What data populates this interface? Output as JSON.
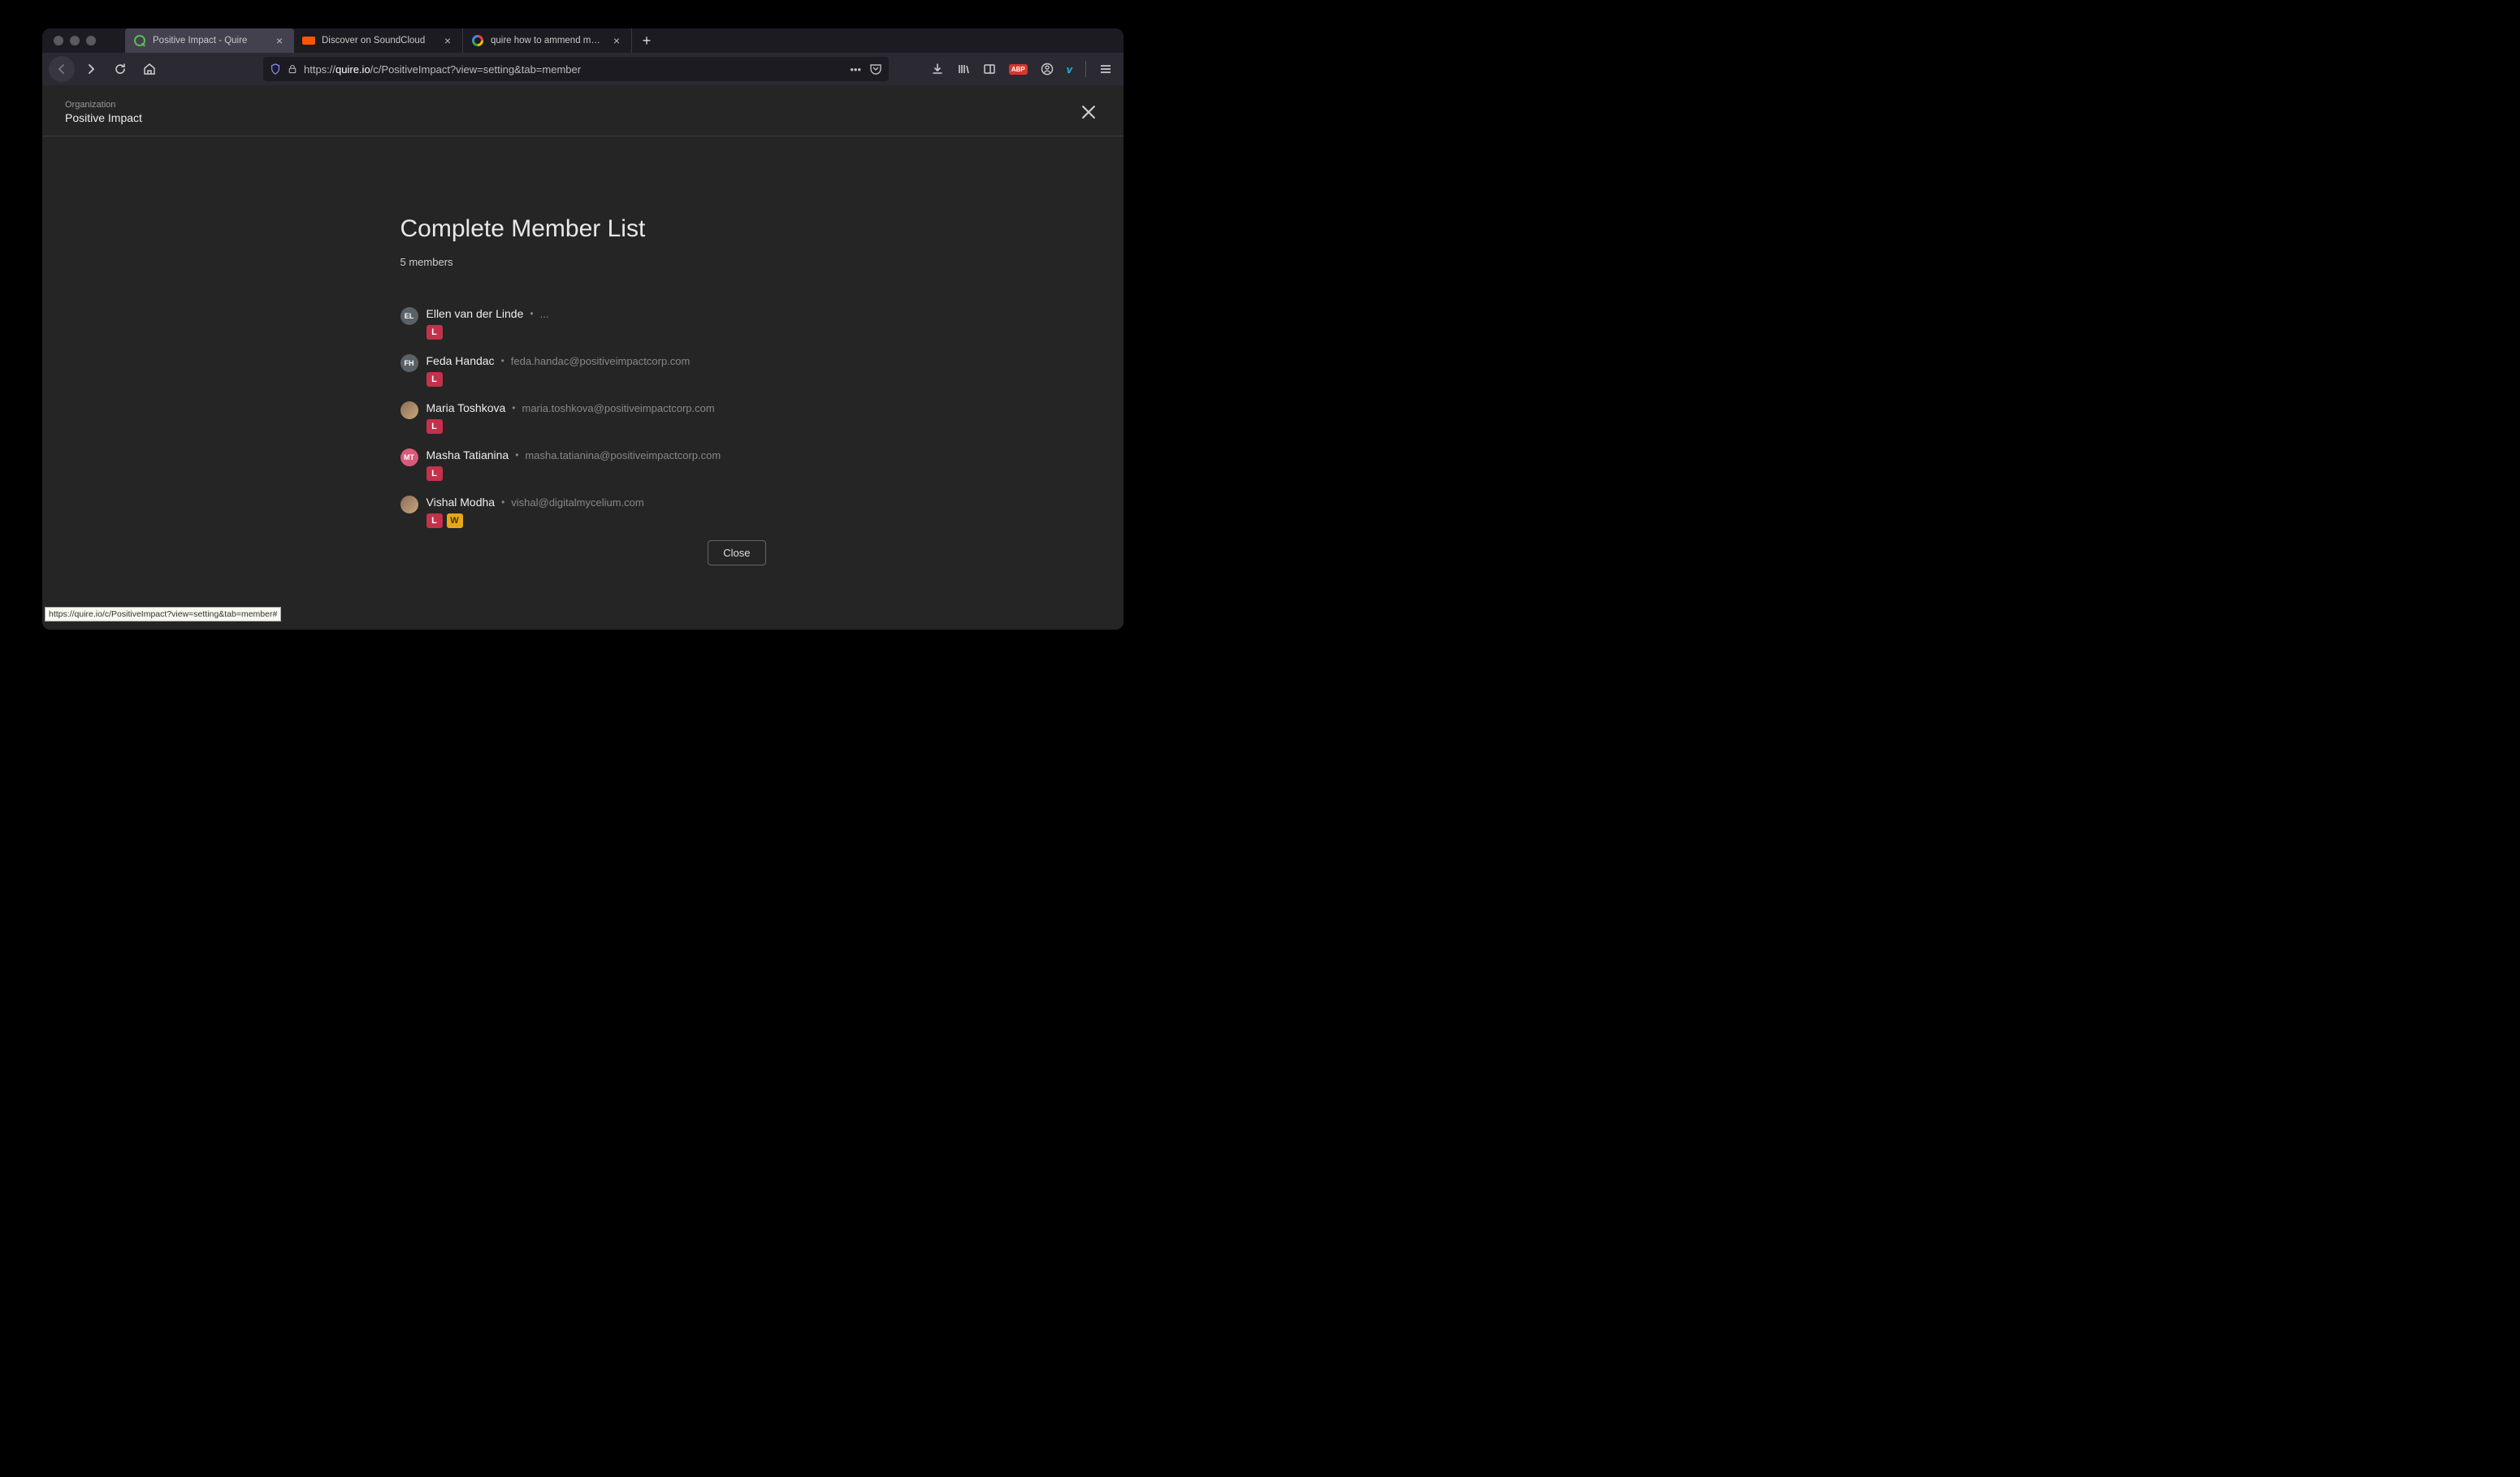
{
  "tabs": [
    {
      "title": "Positive Impact - Quire"
    },
    {
      "title": "Discover on SoundCloud"
    },
    {
      "title": "quire how to ammend members"
    }
  ],
  "url": {
    "protocol": "https://",
    "domain": "quire.io",
    "path": "/c/PositiveImpact?view=setting&tab=member"
  },
  "breadcrumb": {
    "label": "Organization",
    "name": "Positive Impact"
  },
  "title": "Complete Member List",
  "memberCount": "5 members",
  "members": [
    {
      "initials": "EL",
      "avatarColor": "#5a6268",
      "avatarType": "initials",
      "name": "Ellen van der Linde",
      "email": "...",
      "roles": [
        "L"
      ]
    },
    {
      "initials": "FH",
      "avatarColor": "#5a6268",
      "avatarType": "initials",
      "name": "Feda Handac",
      "email": "feda.handac@positiveimpactcorp.com",
      "roles": [
        "L"
      ]
    },
    {
      "initials": "",
      "avatarColor": "",
      "avatarType": "image",
      "name": "Maria Toshkova",
      "email": "maria.toshkova@positiveimpactcorp.com",
      "roles": [
        "L"
      ]
    },
    {
      "initials": "MT",
      "avatarColor": "#d95a7a",
      "avatarType": "initials",
      "name": "Masha Tatianina",
      "email": "masha.tatianina@positiveimpactcorp.com",
      "roles": [
        "L"
      ]
    },
    {
      "initials": "",
      "avatarColor": "",
      "avatarType": "image",
      "name": "Vishal Modha",
      "email": "vishal@digitalmycelium.com",
      "roles": [
        "L",
        "W"
      ]
    }
  ],
  "closeLabel": "Close",
  "statusTooltip": "https://quire.io/c/PositiveImpact?view=setting&tab=member#"
}
